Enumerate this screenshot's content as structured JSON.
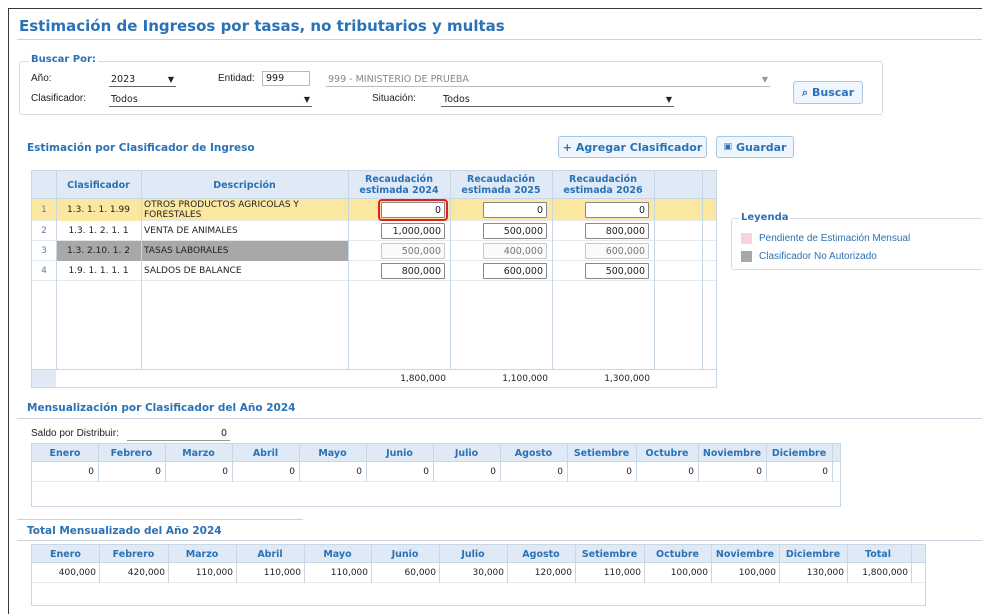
{
  "page": {
    "title": "Estimación de Ingresos por tasas, no tributarios y multas"
  },
  "search": {
    "legend": "Buscar Por:",
    "year_label": "Año:",
    "year_value": "2023",
    "entity_label": "Entidad:",
    "entity_code": "999",
    "entity_name": "999 - MINISTERIO DE PRUEBA",
    "classifier_label": "Clasificador:",
    "classifier_value": "Todos",
    "situation_label": "Situación:",
    "situation_value": "Todos",
    "search_button": "Buscar"
  },
  "estimation": {
    "section_title": "Estimación por Clasificador de Ingreso",
    "add_button": "Agregar Clasificador",
    "save_button": "Guardar",
    "headers": [
      "Clasificador",
      "Descripción",
      "Recaudación estimada 2024",
      "Recaudación estimada 2025",
      "Recaudación estimada 2026"
    ],
    "rows": [
      {
        "n": "1",
        "code": "1.3. 1. 1. 1.99",
        "desc": "OTROS PRODUCTOS AGRICOLAS Y FORESTALES",
        "v2024": "0",
        "v2025": "0",
        "v2026": "0",
        "state": "selected"
      },
      {
        "n": "2",
        "code": "1.3. 1. 2. 1. 1",
        "desc": "VENTA DE ANIMALES",
        "v2024": "1,000,000",
        "v2025": "500,000",
        "v2026": "800,000",
        "state": "normal"
      },
      {
        "n": "3",
        "code": "1.3. 2.10. 1. 2",
        "desc": "TASAS LABORALES",
        "v2024": "500,000",
        "v2025": "400,000",
        "v2026": "600,000",
        "state": "unauthorized"
      },
      {
        "n": "4",
        "code": "1.9. 1. 1. 1. 1",
        "desc": "SALDOS DE BALANCE",
        "v2024": "800,000",
        "v2025": "600,000",
        "v2026": "500,000",
        "state": "normal"
      }
    ],
    "totals": {
      "t2024": "1,800,000",
      "t2025": "1,100,000",
      "t2026": "1,300,000"
    }
  },
  "legend": {
    "title": "Leyenda",
    "items": [
      {
        "label": "Pendiente de Estimación Mensual",
        "color": "#f7d4dc"
      },
      {
        "label": "Clasificador No Autorizado",
        "color": "#a8a8a8"
      }
    ]
  },
  "monthly": {
    "section_title": "Mensualización por Clasificador del Año 2024",
    "saldo_label": "Saldo por Distribuir:",
    "saldo_value": "0",
    "months": [
      "Enero",
      "Febrero",
      "Marzo",
      "Abril",
      "Mayo",
      "Junio",
      "Julio",
      "Agosto",
      "Setiembre",
      "Octubre",
      "Noviembre",
      "Diciembre"
    ],
    "values": [
      "0",
      "0",
      "0",
      "0",
      "0",
      "0",
      "0",
      "0",
      "0",
      "0",
      "0",
      "0"
    ]
  },
  "total_monthly": {
    "section_title": "Total Mensualizado del Año 2024",
    "headers": [
      "Enero",
      "Febrero",
      "Marzo",
      "Abril",
      "Mayo",
      "Junio",
      "Julio",
      "Agosto",
      "Setiembre",
      "Octubre",
      "Noviembre",
      "Diciembre",
      "Total"
    ],
    "values": [
      "400,000",
      "420,000",
      "110,000",
      "110,000",
      "110,000",
      "60,000",
      "30,000",
      "120,000",
      "110,000",
      "100,000",
      "100,000",
      "130,000",
      "1,800,000"
    ]
  },
  "colors": {
    "accent": "#2a72b5",
    "selected_row": "#fbe7a0",
    "unauthorized": "#a8a8a8",
    "header_bg": "#dfeaf6",
    "focus_outline": "#e02020"
  }
}
